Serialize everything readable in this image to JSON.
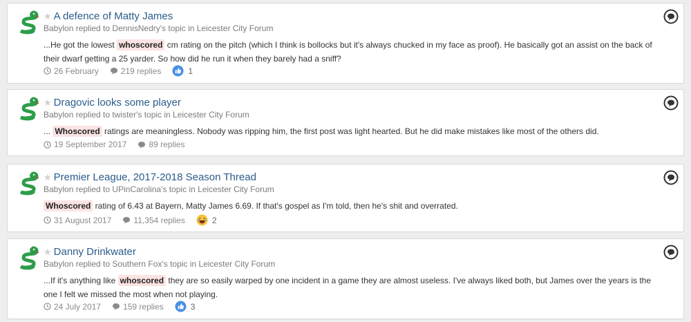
{
  "results": [
    {
      "title": "A defence of Matty James",
      "meta": "Babylon replied to DennisNedry's topic in Leicester City Forum",
      "snippet_before": "...He got the lowest ",
      "highlight": "whoscored",
      "snippet_after": " cm rating on the pitch (which I think is bollocks but it's always chucked in my face as proof). He basically got an assist on the back of their dwarf getting a 25 yarder. So how did he run it when they barely had a sniff?",
      "date": "26 February",
      "replies": "219 replies",
      "reaction": "like",
      "reaction_count": "1"
    },
    {
      "title": "Dragovic looks some player",
      "meta": "Babylon replied to twister's topic in Leicester City Forum",
      "snippet_before": "... ",
      "highlight": "Whoscored",
      "snippet_after": " ratings are meaningless. Nobody was ripping him, the first post was light hearted. But he did make mistakes like most of the others did.",
      "date": "19 September 2017",
      "replies": "89 replies",
      "reaction": "",
      "reaction_count": ""
    },
    {
      "title": "Premier League, 2017-2018 Season Thread",
      "meta": "Babylon replied to UPinCarolina's topic in Leicester City Forum",
      "snippet_before": "",
      "highlight": "Whoscored",
      "snippet_after": " rating of 6.43 at Bayern, Matty James 6.69. If that's gospel as I'm told, then he's shit and overrated.",
      "date": "31 August 2017",
      "replies": "11,354 replies",
      "reaction": "haha",
      "reaction_count": "2"
    },
    {
      "title": "Danny Drinkwater",
      "meta": "Babylon replied to Southern Fox's topic in Leicester City Forum",
      "snippet_before": "...If it's anything like ",
      "highlight": "whoscored",
      "snippet_after": " they are so easily warped by one incident in a game they are almost useless. I've always liked both, but James over the years is the one I felt we missed the most when not playing.",
      "date": "24 July 2017",
      "replies": "159 replies",
      "reaction": "like",
      "reaction_count": "3"
    }
  ],
  "colors": {
    "title": "#2b5c8a",
    "highlight_bg": "#fbe3e3",
    "like_blue": "#4a90e2",
    "avatar_green": "#2e9d4a"
  },
  "icons": {
    "avatar": "snake-emoji",
    "star": "star-icon",
    "date": "clock-icon",
    "replies": "speech-bubble-icon",
    "like": "thumbs-up-icon",
    "haha": "laughing-face-icon",
    "comment": "comment-circle-icon"
  }
}
